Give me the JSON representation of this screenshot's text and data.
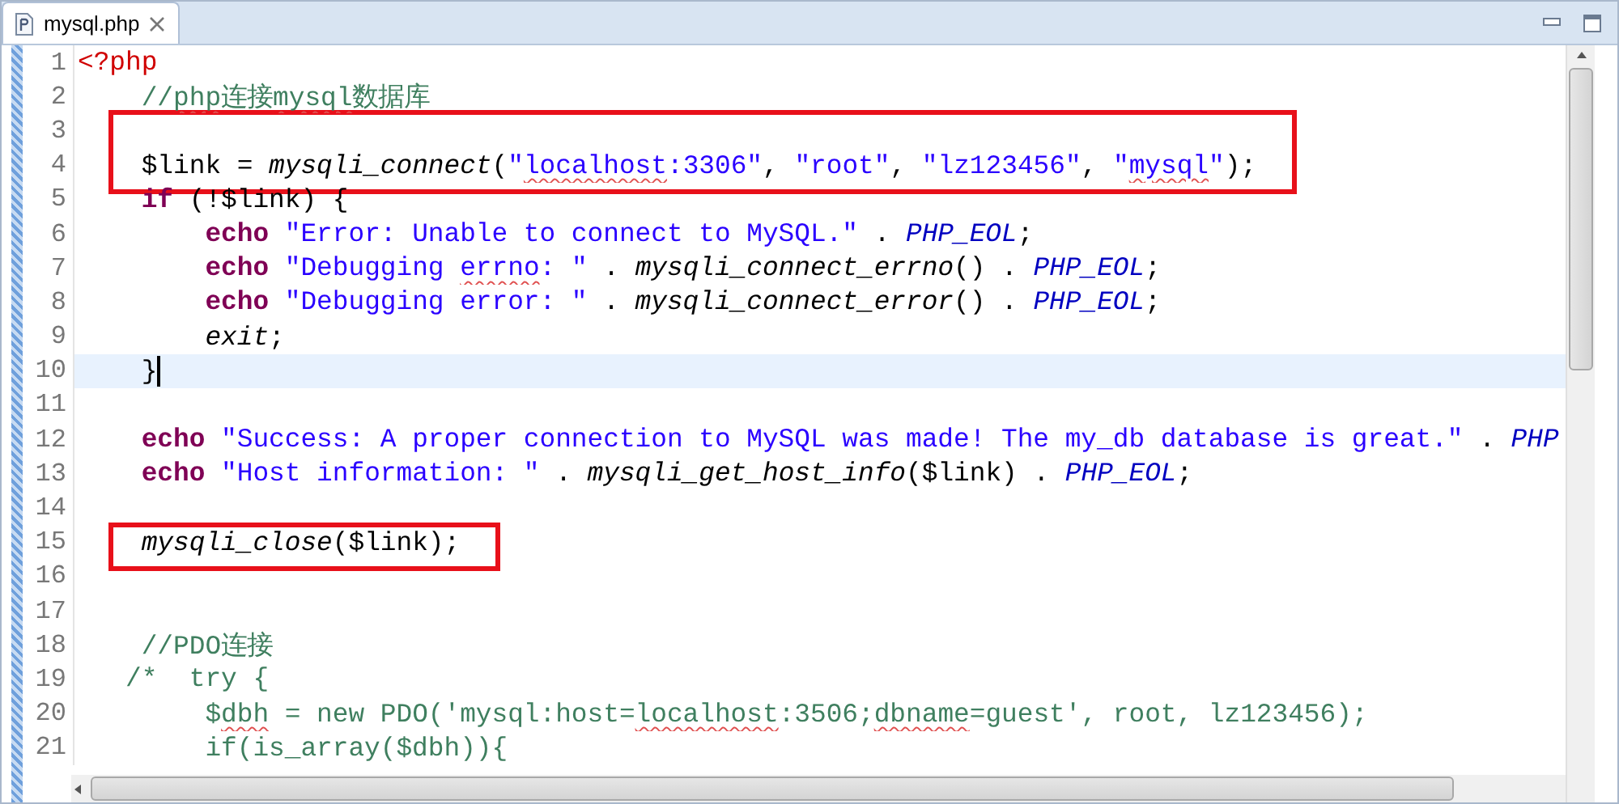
{
  "tab": {
    "title": "mysql.php",
    "selected": true
  },
  "blocks": [
    {
      "boxed": false,
      "lines": [
        {
          "number": "1",
          "current": false,
          "tokens": [
            {
              "kind": "tag",
              "text": "<?php",
              "squiggle": false
            }
          ]
        },
        {
          "number": "2",
          "current": false,
          "tokens": [
            {
              "kind": "comment",
              "text": "    //",
              "squiggle": false
            },
            {
              "kind": "comment",
              "text": "php",
              "squiggle": true
            },
            {
              "kind": "comment",
              "text": "连接",
              "squiggle": false
            },
            {
              "kind": "comment",
              "text": "mysql",
              "squiggle": true
            },
            {
              "kind": "comment",
              "text": "数据库",
              "squiggle": false
            }
          ]
        }
      ]
    },
    {
      "boxed": true,
      "lines": [
        {
          "number": "3",
          "current": false
        },
        {
          "number": "4",
          "current": false,
          "tokens": [
            {
              "kind": "plain",
              "text": "    $link = ",
              "squiggle": false
            },
            {
              "kind": "fn",
              "text": "mysqli_connect",
              "squiggle": false
            },
            {
              "kind": "plain",
              "text": "(",
              "squiggle": false
            },
            {
              "kind": "str",
              "text": "\"",
              "squiggle": false
            },
            {
              "kind": "str",
              "text": "localhost",
              "squiggle": true
            },
            {
              "kind": "str",
              "text": ":3306\"",
              "squiggle": false
            },
            {
              "kind": "plain",
              "text": ", ",
              "squiggle": false
            },
            {
              "kind": "str",
              "text": "\"root\"",
              "squiggle": false
            },
            {
              "kind": "plain",
              "text": ", ",
              "squiggle": false
            },
            {
              "kind": "str",
              "text": "\"lz123456\"",
              "squiggle": false
            },
            {
              "kind": "plain",
              "text": ", ",
              "squiggle": false
            },
            {
              "kind": "str",
              "text": "\"",
              "squiggle": false
            },
            {
              "kind": "str",
              "text": "mysql",
              "squiggle": true
            },
            {
              "kind": "str",
              "text": "\"",
              "squiggle": false
            },
            {
              "kind": "plain",
              "text": ");",
              "squiggle": false
            }
          ]
        }
      ]
    },
    {
      "boxed": false,
      "lines": [
        {
          "number": "5",
          "current": false,
          "tokens": [
            {
              "kind": "kw",
              "text": "    if",
              "squiggle": false
            },
            {
              "kind": "plain",
              "text": " (!$link) {",
              "squiggle": false
            }
          ]
        },
        {
          "number": "6",
          "current": false,
          "tokens": [
            {
              "kind": "kw",
              "text": "        echo",
              "squiggle": false
            },
            {
              "kind": "str",
              "text": " \"Error: Unable to connect to MySQL.\"",
              "squiggle": false
            },
            {
              "kind": "plain",
              "text": " . ",
              "squiggle": false
            },
            {
              "kind": "const",
              "text": "PHP_EOL",
              "squiggle": false
            },
            {
              "kind": "plain",
              "text": ";",
              "squiggle": false
            }
          ]
        },
        {
          "number": "7",
          "current": false,
          "tokens": [
            {
              "kind": "kw",
              "text": "        echo",
              "squiggle": false
            },
            {
              "kind": "str",
              "text": " \"Debugging ",
              "squiggle": false
            },
            {
              "kind": "str",
              "text": "errno",
              "squiggle": true
            },
            {
              "kind": "str",
              "text": ": \"",
              "squiggle": false
            },
            {
              "kind": "plain",
              "text": " . ",
              "squiggle": false
            },
            {
              "kind": "fn",
              "text": "mysqli_connect_errno",
              "squiggle": false
            },
            {
              "kind": "plain",
              "text": "() . ",
              "squiggle": false
            },
            {
              "kind": "const",
              "text": "PHP_EOL",
              "squiggle": false
            },
            {
              "kind": "plain",
              "text": ";",
              "squiggle": false
            }
          ]
        },
        {
          "number": "8",
          "current": false,
          "tokens": [
            {
              "kind": "kw",
              "text": "        echo",
              "squiggle": false
            },
            {
              "kind": "str",
              "text": " \"Debugging error: \"",
              "squiggle": false
            },
            {
              "kind": "plain",
              "text": " . ",
              "squiggle": false
            },
            {
              "kind": "fn",
              "text": "mysqli_connect_error",
              "squiggle": false
            },
            {
              "kind": "plain",
              "text": "() . ",
              "squiggle": false
            },
            {
              "kind": "const",
              "text": "PHP_EOL",
              "squiggle": false
            },
            {
              "kind": "plain",
              "text": ";",
              "squiggle": false
            }
          ]
        },
        {
          "number": "9",
          "current": false,
          "tokens": [
            {
              "kind": "fn",
              "text": "        exit",
              "squiggle": false
            },
            {
              "kind": "plain",
              "text": ";",
              "squiggle": false
            }
          ]
        },
        {
          "number": "10",
          "current": true,
          "tokens": [
            {
              "kind": "plain",
              "text": "    }",
              "squiggle": false
            }
          ]
        },
        {
          "number": "11",
          "current": false
        },
        {
          "number": "12",
          "current": false,
          "tokens": [
            {
              "kind": "kw",
              "text": "    echo",
              "squiggle": false
            },
            {
              "kind": "str",
              "text": " \"Success: A proper connection to MySQL was made! The my_db database is great.\"",
              "squiggle": false
            },
            {
              "kind": "plain",
              "text": " . ",
              "squiggle": false
            },
            {
              "kind": "const",
              "text": "PHP",
              "squiggle": false
            }
          ]
        },
        {
          "number": "13",
          "current": false,
          "tokens": [
            {
              "kind": "kw",
              "text": "    echo",
              "squiggle": false
            },
            {
              "kind": "str",
              "text": " \"Host information: \"",
              "squiggle": false
            },
            {
              "kind": "plain",
              "text": " . ",
              "squiggle": false
            },
            {
              "kind": "fn",
              "text": "mysqli_get_host_info",
              "squiggle": false
            },
            {
              "kind": "plain",
              "text": "($link) . ",
              "squiggle": false
            },
            {
              "kind": "const",
              "text": "PHP_EOL",
              "squiggle": false
            },
            {
              "kind": "plain",
              "text": ";",
              "squiggle": false
            }
          ]
        },
        {
          "number": "14",
          "current": false
        }
      ]
    },
    {
      "boxed": true,
      "lines": [
        {
          "number": "15",
          "current": false,
          "tokens": [
            {
              "kind": "fn",
              "text": "    mysqli_close",
              "squiggle": false
            },
            {
              "kind": "plain",
              "text": "($link);",
              "squiggle": false
            }
          ]
        }
      ]
    },
    {
      "boxed": false,
      "lines": [
        {
          "number": "16",
          "current": false
        },
        {
          "number": "17",
          "current": false
        },
        {
          "number": "18",
          "current": false,
          "tokens": [
            {
              "kind": "comment",
              "text": "    //PDO连接",
              "squiggle": false
            }
          ]
        },
        {
          "number": "19",
          "current": false,
          "tokens": [
            {
              "kind": "comment",
              "text": "   /*  try {",
              "squiggle": false
            }
          ]
        },
        {
          "number": "20",
          "current": false,
          "tokens": [
            {
              "kind": "comment",
              "text": "        $",
              "squiggle": false
            },
            {
              "kind": "comment",
              "text": "dbh",
              "squiggle": true
            },
            {
              "kind": "comment",
              "text": " = new PDO('mysql:host=",
              "squiggle": false
            },
            {
              "kind": "comment",
              "text": "localhost",
              "squiggle": true
            },
            {
              "kind": "comment",
              "text": ":3506;",
              "squiggle": false
            },
            {
              "kind": "comment",
              "text": "dbname",
              "squiggle": true
            },
            {
              "kind": "comment",
              "text": "=guest', root, lz123456);",
              "squiggle": false
            }
          ]
        },
        {
          "number": "21",
          "current": false,
          "tokens": [
            {
              "kind": "comment",
              "text": "        if(is_array($dbh)){",
              "squiggle": false
            }
          ]
        }
      ]
    }
  ]
}
